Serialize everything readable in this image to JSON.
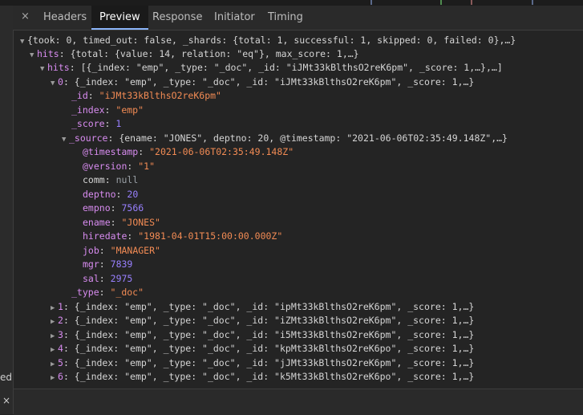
{
  "tabs": {
    "close_glyph": "×",
    "items": [
      "Headers",
      "Preview",
      "Response",
      "Initiator",
      "Timing"
    ],
    "active": "Preview"
  },
  "left_panel": {
    "cut_text": "ed",
    "close_glyph": "×"
  },
  "tree": {
    "root_summary": "{took: 0, timed_out: false, _shards: {total: 1, successful: 1, skipped: 0, failed: 0},…}",
    "hits_key": "hits",
    "hits_summary": "{total: {value: 14, relation: \"eq\"}, max_score: 1,…}",
    "hits_hits_key": "hits",
    "hits_hits_summary": "[{_index: \"emp\", _type: \"_doc\", _id: \"iJMt33kBlthsO2reK6pm\", _score: 1,…},…]",
    "item0_key": "0",
    "item0_summary": "{_index: \"emp\", _type: \"_doc\", _id: \"iJMt33kBlthsO2reK6pm\", _score: 1,…}",
    "id_key": "_id",
    "id_val": "\"iJMt33kBlthsO2reK6pm\"",
    "index_key": "_index",
    "index_val": "\"emp\"",
    "score_key": "_score",
    "score_val": "1",
    "source_key": "_source",
    "source_summary": "{ename: \"JONES\", deptno: 20, @timestamp: \"2021-06-06T02:35:49.148Z\",…}",
    "ts_key": "@timestamp",
    "ts_val": "\"2021-06-06T02:35:49.148Z\"",
    "ver_key": "@version",
    "ver_val": "\"1\"",
    "comm_key": "comm",
    "comm_val": "null",
    "deptno_key": "deptno",
    "deptno_val": "20",
    "empno_key": "empno",
    "empno_val": "7566",
    "ename_key": "ename",
    "ename_val": "\"JONES\"",
    "hiredate_key": "hiredate",
    "hiredate_val": "\"1981-04-01T15:00:00.000Z\"",
    "job_key": "job",
    "job_val": "\"MANAGER\"",
    "mgr_key": "mgr",
    "mgr_val": "7839",
    "sal_key": "sal",
    "sal_val": "2975",
    "type_key": "_type",
    "type_val": "\"_doc\"",
    "collapsed_items": [
      {
        "idx": "1",
        "summary": "{_index: \"emp\", _type: \"_doc\", _id: \"ipMt33kBlthsO2reK6pm\", _score: 1,…}"
      },
      {
        "idx": "2",
        "summary": "{_index: \"emp\", _type: \"_doc\", _id: \"iZMt33kBlthsO2reK6pm\", _score: 1,…}"
      },
      {
        "idx": "3",
        "summary": "{_index: \"emp\", _type: \"_doc\", _id: \"i5Mt33kBlthsO2reK6pm\", _score: 1,…}"
      },
      {
        "idx": "4",
        "summary": "{_index: \"emp\", _type: \"_doc\", _id: \"kpMt33kBlthsO2reK6po\", _score: 1,…}"
      },
      {
        "idx": "5",
        "summary": "{_index: \"emp\", _type: \"_doc\", _id: \"jJMt33kBlthsO2reK6pm\", _score: 1,…}"
      },
      {
        "idx": "6",
        "summary": "{_index: \"emp\", _type: \"_doc\", _id: \"k5Mt33kBlthsO2reK6po\", _score: 1,…}"
      }
    ]
  },
  "colors": {
    "key": "#d88cf0",
    "string": "#f28b54",
    "number": "#9980ff",
    "active_tab_bg": "#1a1a1a",
    "background": "#242424"
  }
}
